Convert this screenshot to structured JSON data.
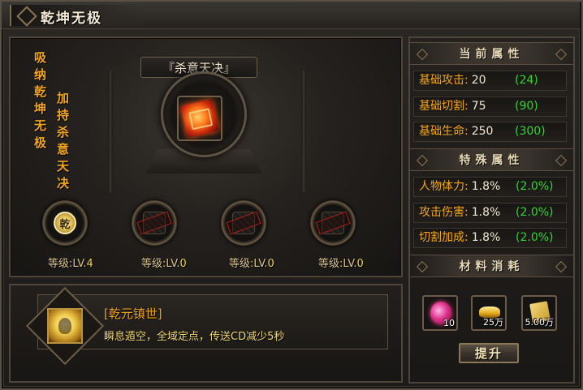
{
  "window": {
    "title": "乾坤无极"
  },
  "left": {
    "vertical_text_1": "吸纳乾坤无极",
    "vertical_text_2": "加持杀意天决",
    "skill_name": "『杀意天决』",
    "nodes": [
      {
        "icon_text": "乾",
        "state": "active",
        "level_prefix": "等级:LV.",
        "level": "4"
      },
      {
        "icon_text": "",
        "state": "locked",
        "level_prefix": "等级:LV.",
        "level": "0"
      },
      {
        "icon_text": "",
        "state": "locked",
        "level_prefix": "等级:LV.",
        "level": "0"
      },
      {
        "icon_text": "",
        "state": "locked",
        "level_prefix": "等级:LV.",
        "level": "0"
      }
    ],
    "description": {
      "title": "[乾元镇世]",
      "body": "瞬息遁空，全域定点，传送CD减少5秒"
    }
  },
  "right": {
    "current_attributes": {
      "header": "当前属性",
      "rows": [
        {
          "label": "基础攻击:",
          "value": "20",
          "bonus": "(24)"
        },
        {
          "label": "基础切割:",
          "value": "75",
          "bonus": "(90)"
        },
        {
          "label": "基础生命:",
          "value": "250",
          "bonus": "(300)"
        }
      ]
    },
    "special_attributes": {
      "header": "特殊属性",
      "rows": [
        {
          "label": "人物体力:",
          "value": "1.8%",
          "bonus": "(2.0%)"
        },
        {
          "label": "攻击伤害:",
          "value": "1.8%",
          "bonus": "(2.0%)"
        },
        {
          "label": "切割加成:",
          "value": "1.8%",
          "bonus": "(2.0%)"
        }
      ]
    },
    "materials": {
      "header": "材料消耗",
      "items": [
        {
          "icon": "gem-icon",
          "count": "10"
        },
        {
          "icon": "gold-ingot-icon",
          "count": "25万"
        },
        {
          "icon": "scroll-icon",
          "count": "5.00万"
        }
      ]
    },
    "upgrade_label": "提升"
  },
  "colors": {
    "accent_orange": "#f2a51a",
    "bonus_green": "#2fd52b",
    "level_yellow": "#f6d23c"
  }
}
